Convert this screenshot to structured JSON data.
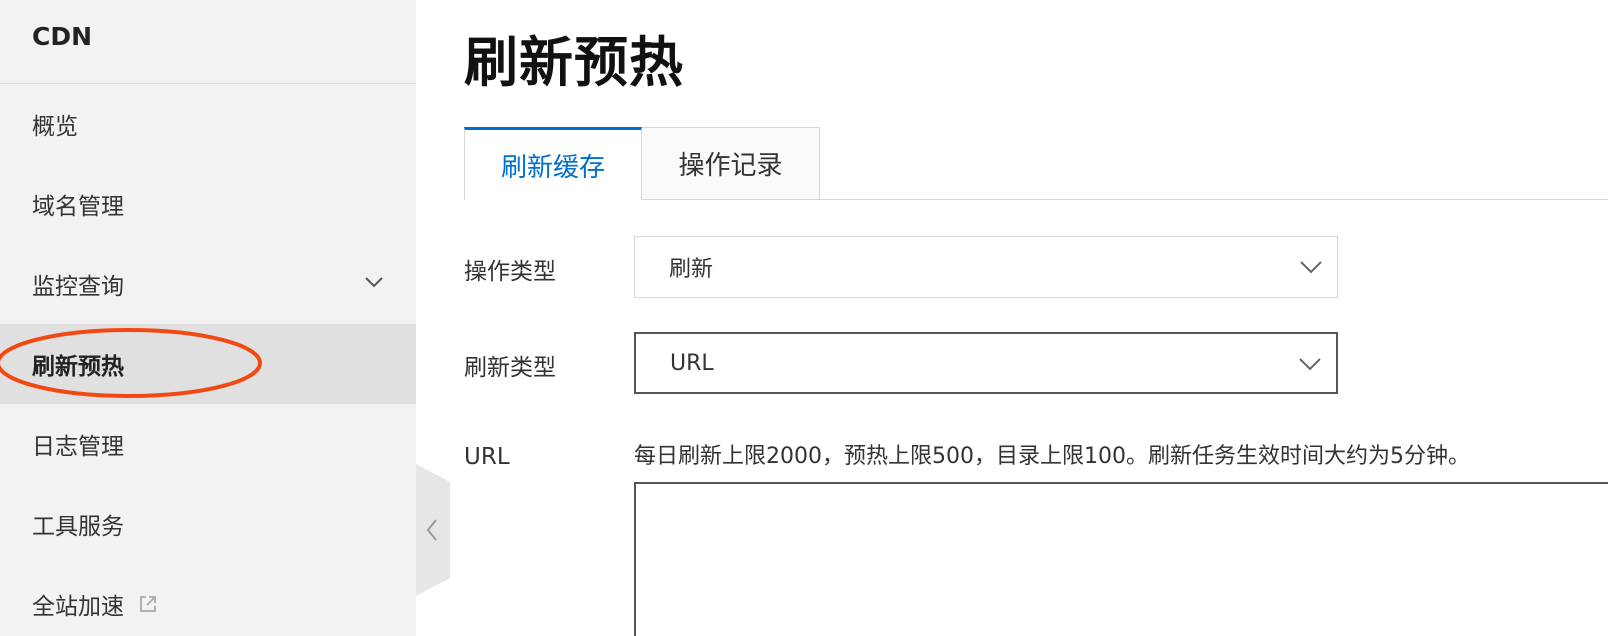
{
  "sidebar": {
    "brand": "CDN",
    "items": [
      {
        "label": "概览"
      },
      {
        "label": "域名管理"
      },
      {
        "label": "监控查询"
      },
      {
        "label": "刷新预热"
      },
      {
        "label": "日志管理"
      },
      {
        "label": "工具服务"
      },
      {
        "label": "全站加速"
      }
    ]
  },
  "main": {
    "title": "刷新预热",
    "tabs": [
      {
        "label": "刷新缓存"
      },
      {
        "label": "操作记录"
      }
    ],
    "form": {
      "operation_type_label": "操作类型",
      "operation_type_value": "刷新",
      "refresh_type_label": "刷新类型",
      "refresh_type_value": "URL",
      "url_label": "URL",
      "url_hint": "每日刷新上限2000，预热上限500，目录上限100。刷新任务生效时间大约为5分钟。",
      "url_value": ""
    }
  },
  "colors": {
    "accent": "#0070cc",
    "annotation": "#f04a12",
    "sidebar_bg": "#f2f2f2",
    "sidebar_active_bg": "#e0e0e0"
  },
  "icons": {
    "expand": "chevron-down-icon",
    "external": "external-link-icon",
    "collapse": "chevron-left-icon",
    "select": "chevron-down-icon"
  }
}
